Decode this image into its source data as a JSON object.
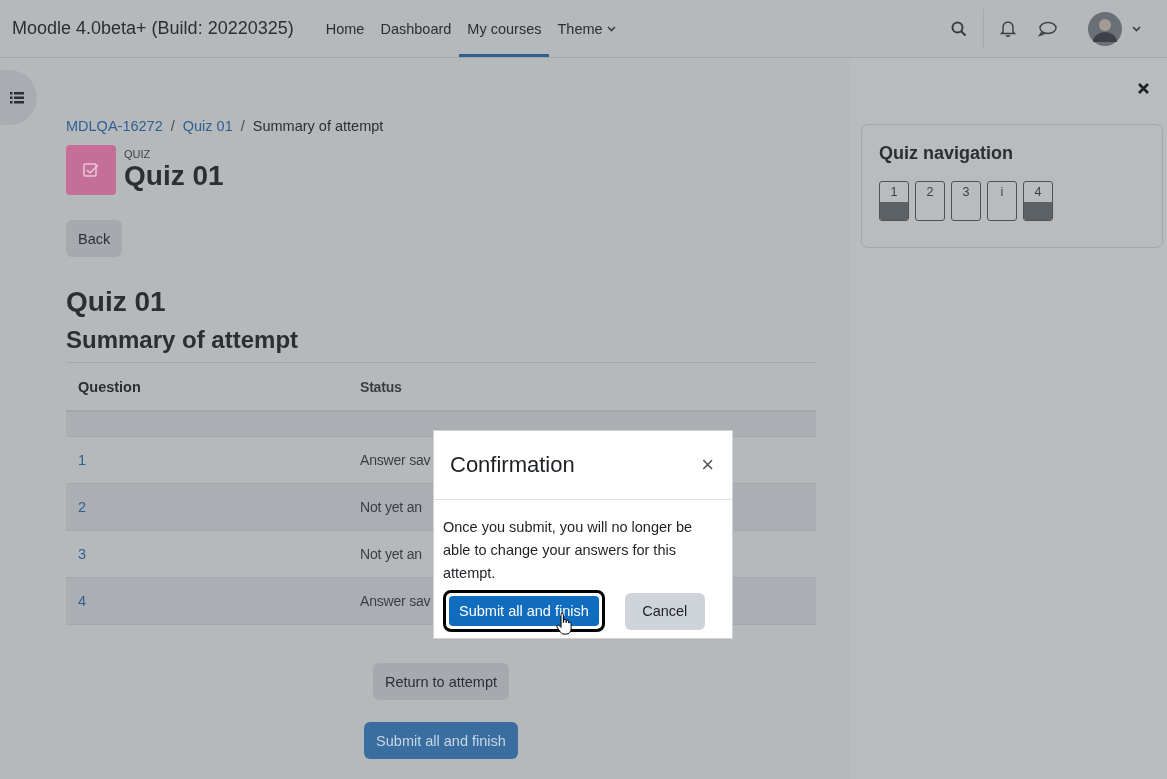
{
  "navbar": {
    "site_name": "Moodle 4.0beta+ (Build: 20220325)",
    "links": [
      {
        "label": "Home",
        "selected": false,
        "dropdown": false
      },
      {
        "label": "Dashboard",
        "selected": false,
        "dropdown": false
      },
      {
        "label": "My courses",
        "selected": true,
        "dropdown": false
      },
      {
        "label": "Theme",
        "selected": false,
        "dropdown": true
      }
    ]
  },
  "breadcrumb": [
    {
      "label": "MDLQA-16272",
      "kind": "link"
    },
    {
      "label": "/",
      "kind": "separator"
    },
    {
      "label": "Quiz 01",
      "kind": "link"
    },
    {
      "label": "/",
      "kind": "separator"
    },
    {
      "label": "Summary of attempt",
      "kind": "current"
    }
  ],
  "activity": {
    "type": "QUIZ",
    "name": "Quiz 01"
  },
  "back_button": "Back",
  "heading": "Quiz 01",
  "subheading": "Summary of attempt",
  "table": {
    "columns": [
      "Question",
      "Status"
    ],
    "rows": [
      {
        "question": "1",
        "status": "Answer sav"
      },
      {
        "question": "2",
        "status": "Not yet an"
      },
      {
        "question": "3",
        "status": "Not yet an"
      },
      {
        "question": "4",
        "status": "Answer sav"
      }
    ]
  },
  "return_button": "Return to attempt",
  "submit_button": "Submit all and finish",
  "quiz_navigation": {
    "title": "Quiz navigation",
    "items": [
      {
        "label": "1",
        "answered": true
      },
      {
        "label": "2",
        "answered": false
      },
      {
        "label": "3",
        "answered": false
      },
      {
        "label": "i",
        "answered": false
      },
      {
        "label": "4",
        "answered": true
      }
    ]
  },
  "dialog": {
    "title": "Confirmation",
    "close": "×",
    "message": "Once you submit, you will no longer be able to change your answers for this attempt.",
    "primary_button": "Submit all and finish",
    "secondary_button": "Cancel"
  }
}
